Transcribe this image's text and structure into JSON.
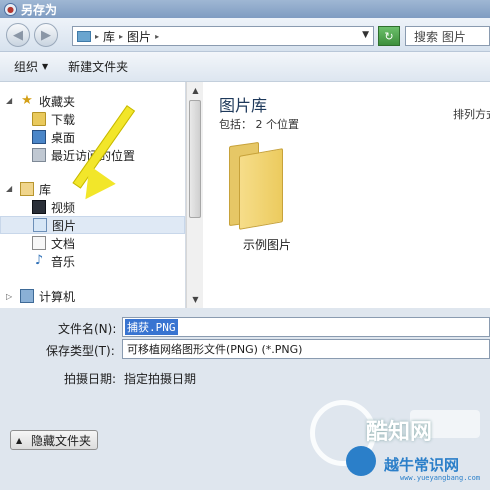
{
  "window": {
    "title": "另存为"
  },
  "nav": {
    "back_icon": "back-arrow-icon",
    "forward_icon": "forward-arrow-icon",
    "address_segments": [
      "库",
      "图片"
    ],
    "search_placeholder": "搜索 图片"
  },
  "toolbar": {
    "organize": "组织",
    "new_folder": "新建文件夹"
  },
  "sidebar": {
    "favorites": "收藏夹",
    "downloads": "下载",
    "desktop": "桌面",
    "recent": "最近访问的位置",
    "libraries": "库",
    "videos": "视频",
    "pictures": "图片",
    "documents": "文档",
    "music": "音乐",
    "computer": "计算机"
  },
  "content": {
    "title": "图片库",
    "subtitle": "包括： 2 个位置",
    "arrange": "排列方式：",
    "folder_label": "示例图片"
  },
  "form": {
    "filename_label": "文件名(N):",
    "filename_value": "捕获.PNG",
    "type_label": "保存类型(T):",
    "type_value": "可移植网络图形文件(PNG) (*.PNG)",
    "date_label": "拍摄日期:",
    "date_value": "指定拍摄日期",
    "hide_folders": "隐藏文件夹"
  },
  "watermark": {
    "name": "酷知网",
    "site": "越牛常识网",
    "url": "www.yueyangbang.com"
  },
  "colors": {
    "selection": "#3874d1",
    "arrow": "#f2e62a"
  }
}
